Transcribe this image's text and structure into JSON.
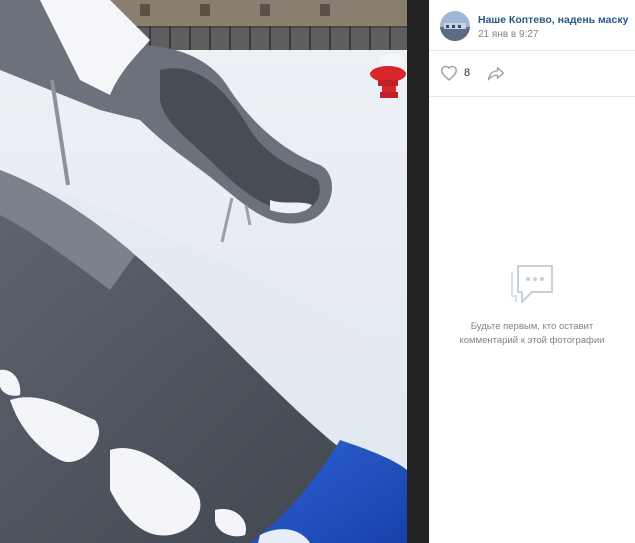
{
  "post": {
    "author_name": "Наше Коптево, надень маску",
    "date": "21 янв в 9:27"
  },
  "actions": {
    "like_count": "8"
  },
  "comments": {
    "empty_line1": "Будьте первым, кто оставит",
    "empty_line2": "комментарий к этой фотографии"
  },
  "colors": {
    "link": "#2a5885",
    "muted": "#828282",
    "divider": "#e7e8ec",
    "icon": "#99a2ad"
  },
  "icons": [
    "heart-icon",
    "share-arrow-icon",
    "comment-bubble-icon"
  ]
}
